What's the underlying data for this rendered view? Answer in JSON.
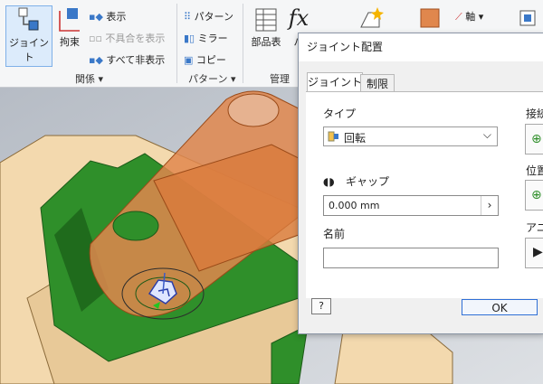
{
  "ribbon": {
    "joint_label": "ジョイント",
    "constrain_label": "拘束",
    "show_label": "表示",
    "show_sick_label": "不具合を表示",
    "hide_all_label": "すべて非表示",
    "relations_group": "関係 ▾",
    "pattern_label": "パターン",
    "mirror_label": "ミラー",
    "copy_label": "コピー",
    "pattern_group": "パターン ▾",
    "bom_label": "部品表",
    "params_label": "パ",
    "manage_group": "管理",
    "axis_label": "軸 ▾"
  },
  "dialog": {
    "title": "ジョイント配置",
    "tabs": [
      "ジョイント",
      "制限"
    ],
    "type_label": "タイプ",
    "type_value": "回転",
    "gap_label": "ギャップ",
    "gap_value": "0.000 mm",
    "name_label": "名前",
    "name_value": "",
    "connect_label": "接続",
    "position_label": "位置",
    "animate_label": "アニ",
    "ok_label": "OK",
    "help_label": "?"
  },
  "colors": {
    "accent": "#2f6fd6",
    "part_beige": "#f3d9ae",
    "part_green": "#2f8f2a",
    "part_orange": "#e0874d"
  }
}
